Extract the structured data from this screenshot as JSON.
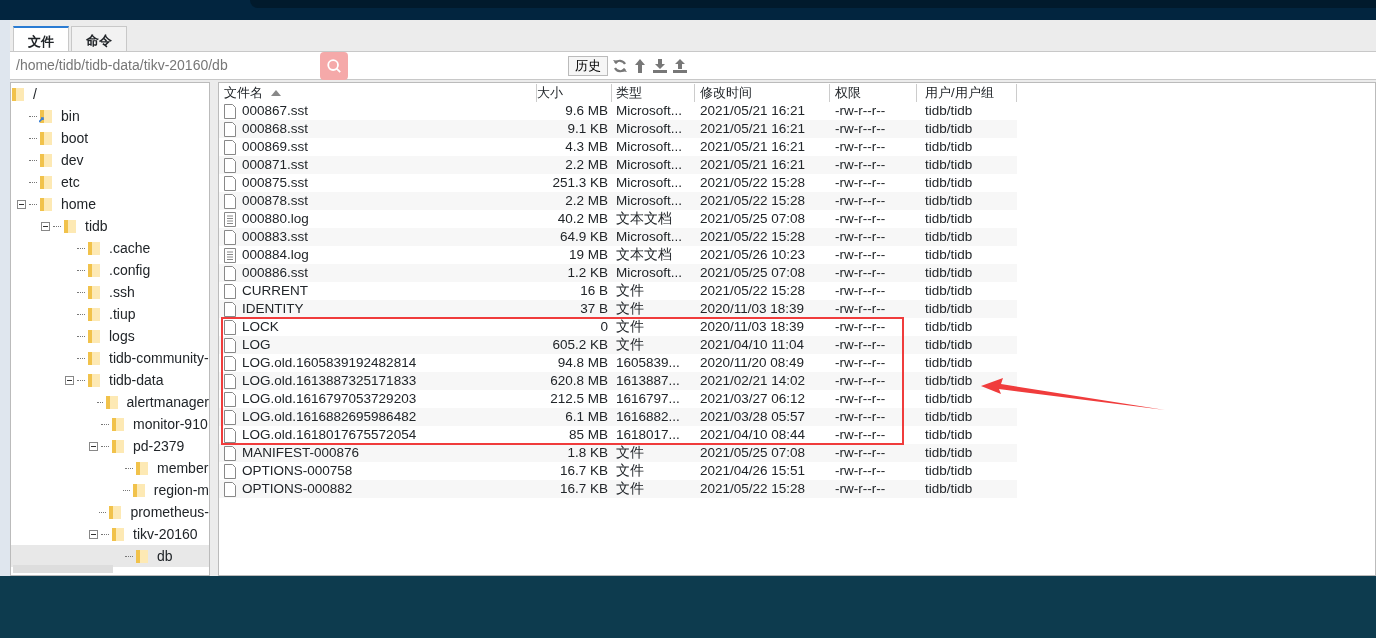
{
  "tabs": [
    {
      "label": "文件",
      "selected": true
    },
    {
      "label": "命令",
      "selected": false
    }
  ],
  "path_bar": {
    "path": "/home/tidb/tidb-data/tikv-20160/db",
    "history_button": "历史"
  },
  "tree": [
    {
      "label": "/",
      "selected": false,
      "children": [
        {
          "label": "bin",
          "link": true,
          "selected": false
        },
        {
          "label": "boot",
          "selected": false
        },
        {
          "label": "dev",
          "selected": false
        },
        {
          "label": "etc",
          "selected": false
        },
        {
          "label": "home",
          "expanded": true,
          "selected": false,
          "children": [
            {
              "label": "tidb",
              "expanded": true,
              "selected": false,
              "children": [
                {
                  "label": ".cache",
                  "selected": false
                },
                {
                  "label": ".config",
                  "selected": false
                },
                {
                  "label": ".ssh",
                  "selected": false
                },
                {
                  "label": ".tiup",
                  "selected": false
                },
                {
                  "label": "logs",
                  "selected": false
                },
                {
                  "label": "tidb-community-",
                  "selected": false
                },
                {
                  "label": "tidb-data",
                  "expanded": true,
                  "selected": false,
                  "children": [
                    {
                      "label": "alertmanager",
                      "selected": false
                    },
                    {
                      "label": "monitor-910",
                      "selected": false
                    },
                    {
                      "label": "pd-2379",
                      "expanded": true,
                      "selected": false,
                      "children": [
                        {
                          "label": "member",
                          "selected": false
                        },
                        {
                          "label": "region-m",
                          "selected": false
                        }
                      ]
                    },
                    {
                      "label": "prometheus-",
                      "selected": false
                    },
                    {
                      "label": "tikv-20160",
                      "expanded": true,
                      "selected": false,
                      "children": [
                        {
                          "label": "db",
                          "selected": true
                        }
                      ]
                    }
                  ]
                }
              ]
            }
          ]
        }
      ]
    }
  ],
  "table": {
    "columns": [
      {
        "label": "文件名",
        "sorted": true
      },
      {
        "label": "大小",
        "sorted": false
      },
      {
        "label": "类型",
        "sorted": false
      },
      {
        "label": "修改时间",
        "sorted": false
      },
      {
        "label": "权限",
        "sorted": false
      },
      {
        "label": "用户/用户组",
        "sorted": false
      }
    ],
    "rows": [
      {
        "kind": "file",
        "name": "000867.sst",
        "size": "9.6 MB",
        "type": "Microsoft...",
        "modified": "2021/05/21 16:21",
        "permissions": "-rw-r--r--",
        "owner": "tidb/tidb",
        "boxed": false
      },
      {
        "kind": "file",
        "name": "000868.sst",
        "size": "9.1 KB",
        "type": "Microsoft...",
        "modified": "2021/05/21 16:21",
        "permissions": "-rw-r--r--",
        "owner": "tidb/tidb",
        "boxed": false
      },
      {
        "kind": "file",
        "name": "000869.sst",
        "size": "4.3 MB",
        "type": "Microsoft...",
        "modified": "2021/05/21 16:21",
        "permissions": "-rw-r--r--",
        "owner": "tidb/tidb",
        "boxed": false
      },
      {
        "kind": "file",
        "name": "000871.sst",
        "size": "2.2 MB",
        "type": "Microsoft...",
        "modified": "2021/05/21 16:21",
        "permissions": "-rw-r--r--",
        "owner": "tidb/tidb",
        "boxed": false
      },
      {
        "kind": "file",
        "name": "000875.sst",
        "size": "251.3 KB",
        "type": "Microsoft...",
        "modified": "2021/05/22 15:28",
        "permissions": "-rw-r--r--",
        "owner": "tidb/tidb",
        "boxed": false
      },
      {
        "kind": "file",
        "name": "000878.sst",
        "size": "2.2 MB",
        "type": "Microsoft...",
        "modified": "2021/05/22 15:28",
        "permissions": "-rw-r--r--",
        "owner": "tidb/tidb",
        "boxed": false
      },
      {
        "kind": "text",
        "name": "000880.log",
        "size": "40.2 MB",
        "type": "文本文档",
        "modified": "2021/05/25 07:08",
        "permissions": "-rw-r--r--",
        "owner": "tidb/tidb",
        "boxed": false
      },
      {
        "kind": "file",
        "name": "000883.sst",
        "size": "64.9 KB",
        "type": "Microsoft...",
        "modified": "2021/05/22 15:28",
        "permissions": "-rw-r--r--",
        "owner": "tidb/tidb",
        "boxed": false
      },
      {
        "kind": "text",
        "name": "000884.log",
        "size": "19 MB",
        "type": "文本文档",
        "modified": "2021/05/26 10:23",
        "permissions": "-rw-r--r--",
        "owner": "tidb/tidb",
        "boxed": false
      },
      {
        "kind": "file",
        "name": "000886.sst",
        "size": "1.2 KB",
        "type": "Microsoft...",
        "modified": "2021/05/25 07:08",
        "permissions": "-rw-r--r--",
        "owner": "tidb/tidb",
        "boxed": false
      },
      {
        "kind": "file",
        "name": "CURRENT",
        "size": "16 B",
        "type": "文件",
        "modified": "2021/05/22 15:28",
        "permissions": "-rw-r--r--",
        "owner": "tidb/tidb",
        "boxed": false
      },
      {
        "kind": "file",
        "name": "IDENTITY",
        "size": "37 B",
        "type": "文件",
        "modified": "2020/11/03 18:39",
        "permissions": "-rw-r--r--",
        "owner": "tidb/tidb",
        "boxed": false
      },
      {
        "kind": "file",
        "name": "LOCK",
        "size": "0",
        "type": "文件",
        "modified": "2020/11/03 18:39",
        "permissions": "-rw-r--r--",
        "owner": "tidb/tidb",
        "boxed": true
      },
      {
        "kind": "file",
        "name": "LOG",
        "size": "605.2 KB",
        "type": "文件",
        "modified": "2021/04/10 11:04",
        "permissions": "-rw-r--r--",
        "owner": "tidb/tidb",
        "boxed": true
      },
      {
        "kind": "file",
        "name": "LOG.old.1605839192482814",
        "size": "94.8 MB",
        "type": "1605839...",
        "modified": "2020/11/20 08:49",
        "permissions": "-rw-r--r--",
        "owner": "tidb/tidb",
        "boxed": true
      },
      {
        "kind": "file",
        "name": "LOG.old.1613887325171833",
        "size": "620.8 MB",
        "type": "1613887...",
        "modified": "2021/02/21 14:02",
        "permissions": "-rw-r--r--",
        "owner": "tidb/tidb",
        "boxed": true
      },
      {
        "kind": "file",
        "name": "LOG.old.1616797053729203",
        "size": "212.5 MB",
        "type": "1616797...",
        "modified": "2021/03/27 06:12",
        "permissions": "-rw-r--r--",
        "owner": "tidb/tidb",
        "boxed": true
      },
      {
        "kind": "file",
        "name": "LOG.old.1616882695986482",
        "size": "6.1 MB",
        "type": "1616882...",
        "modified": "2021/03/28 05:57",
        "permissions": "-rw-r--r--",
        "owner": "tidb/tidb",
        "boxed": true
      },
      {
        "kind": "file",
        "name": "LOG.old.1618017675572054",
        "size": "85 MB",
        "type": "1618017...",
        "modified": "2021/04/10 08:44",
        "permissions": "-rw-r--r--",
        "owner": "tidb/tidb",
        "boxed": true
      },
      {
        "kind": "file",
        "name": "MANIFEST-000876",
        "size": "1.8 KB",
        "type": "文件",
        "modified": "2021/05/25 07:08",
        "permissions": "-rw-r--r--",
        "owner": "tidb/tidb",
        "boxed": false
      },
      {
        "kind": "file",
        "name": "OPTIONS-000758",
        "size": "16.7 KB",
        "type": "文件",
        "modified": "2021/04/26 15:51",
        "permissions": "-rw-r--r--",
        "owner": "tidb/tidb",
        "boxed": false
      },
      {
        "kind": "file",
        "name": "OPTIONS-000882",
        "size": "16.7 KB",
        "type": "文件",
        "modified": "2021/05/22 15:28",
        "permissions": "-rw-r--r--",
        "owner": "tidb/tidb",
        "boxed": false
      }
    ]
  },
  "highlight_box": {
    "color": "#f03c3c"
  },
  "arrow": {
    "color": "#f03c3c"
  }
}
